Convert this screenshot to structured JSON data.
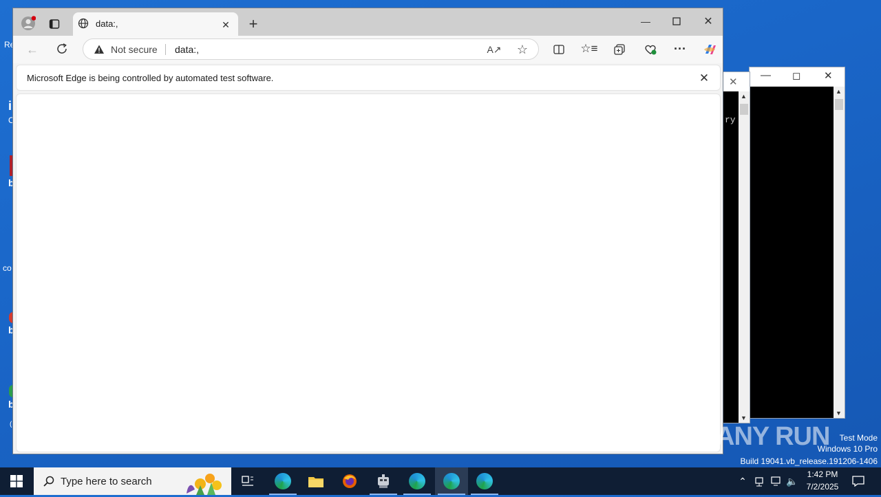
{
  "desktop": {
    "edge_fragments": [
      "Re",
      "i",
      "C",
      "b",
      "co",
      "b",
      "b",
      "("
    ]
  },
  "browser": {
    "tab_title": "data:,",
    "omnibox": {
      "security_label": "Not secure",
      "url": "data:,"
    },
    "infobar_text": "Microsoft Edge is being controlled by automated test software."
  },
  "console": {
    "fragment_text": "ry"
  },
  "watermark": {
    "logo_text": "ANY RUN",
    "line1": "Test Mode",
    "line2": "Windows 10 Pro",
    "line3": "Build 19041.vb_release.191206-1406"
  },
  "taskbar": {
    "search_placeholder": "Type here to search",
    "time": "1:42 PM",
    "date": "7/2/2025"
  },
  "colors": {
    "accent": "#0f6cbd",
    "desktop": "#1a66c8",
    "taskbar": "#0f1e34"
  }
}
